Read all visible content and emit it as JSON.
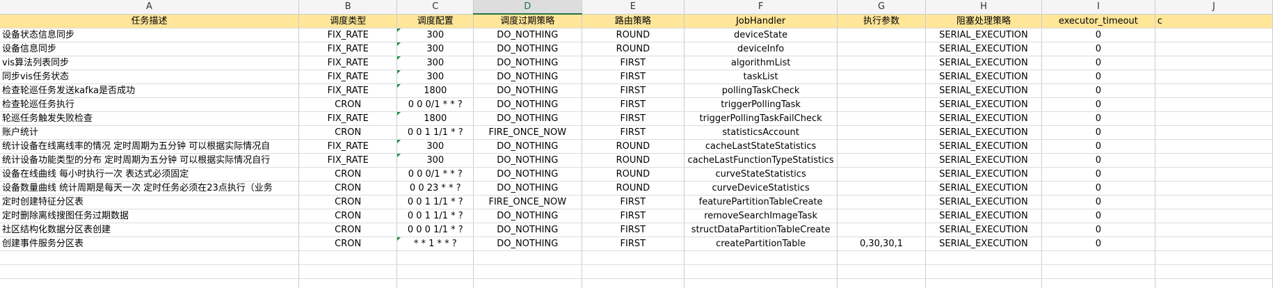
{
  "columns": [
    "A",
    "B",
    "C",
    "D",
    "E",
    "F",
    "G",
    "H",
    "I",
    "J"
  ],
  "active_column_index": 3,
  "colors": {
    "header_fill": "#ffe699",
    "active_column_header": "#217346",
    "comment_flag": "#1e8e3e"
  },
  "header": [
    "任务描述",
    "调度类型",
    "调度配置",
    "调度过期策略",
    "路由策略",
    "JobHandler",
    "执行参数",
    "阻塞处理策略",
    "executor_timeout",
    "c"
  ],
  "rows": [
    {
      "cells": [
        "设备状态信息同步",
        "FIX_RATE",
        "300",
        "DO_NOTHING",
        "ROUND",
        "deviceState",
        "",
        "SERIAL_EXECUTION",
        "0",
        ""
      ],
      "flag": true
    },
    {
      "cells": [
        "设备信息同步",
        "FIX_RATE",
        "300",
        "DO_NOTHING",
        "ROUND",
        "deviceInfo",
        "",
        "SERIAL_EXECUTION",
        "0",
        ""
      ],
      "flag": true
    },
    {
      "cells": [
        "vis算法列表同步",
        "FIX_RATE",
        "300",
        "DO_NOTHING",
        "FIRST",
        "algorithmList",
        "",
        "SERIAL_EXECUTION",
        "0",
        ""
      ],
      "flag": true
    },
    {
      "cells": [
        "同步vis任务状态",
        "FIX_RATE",
        "300",
        "DO_NOTHING",
        "FIRST",
        "taskList",
        "",
        "SERIAL_EXECUTION",
        "0",
        ""
      ],
      "flag": true
    },
    {
      "cells": [
        "检查轮巡任务发送kafka是否成功",
        "FIX_RATE",
        "1800",
        "DO_NOTHING",
        "FIRST",
        "pollingTaskCheck",
        "",
        "SERIAL_EXECUTION",
        "0",
        ""
      ],
      "flag": true
    },
    {
      "cells": [
        "检查轮巡任务执行",
        "CRON",
        "0 0 0/1 * * ?",
        "DO_NOTHING",
        "FIRST",
        "triggerPollingTask",
        "",
        "SERIAL_EXECUTION",
        "0",
        ""
      ],
      "flag": false
    },
    {
      "cells": [
        "轮巡任务触发失败检查",
        "FIX_RATE",
        "1800",
        "DO_NOTHING",
        "FIRST",
        "triggerPollingTaskFailCheck",
        "",
        "SERIAL_EXECUTION",
        "0",
        ""
      ],
      "flag": true
    },
    {
      "cells": [
        "账户统计",
        "CRON",
        "0 0 1 1/1 * ?",
        "FIRE_ONCE_NOW",
        "FIRST",
        "statisticsAccount",
        "",
        "SERIAL_EXECUTION",
        "0",
        ""
      ],
      "flag": false
    },
    {
      "cells": [
        "统计设备在线离线率的情况 定时周期为五分钟 可以根据实际情况自",
        "FIX_RATE",
        "300",
        "DO_NOTHING",
        "ROUND",
        "cacheLastStateStatistics",
        "",
        "SERIAL_EXECUTION",
        "0",
        ""
      ],
      "flag": true
    },
    {
      "cells": [
        "统计设备功能类型的分布 定时周期为五分钟 可以根据实际情况自行",
        "FIX_RATE",
        "300",
        "DO_NOTHING",
        "ROUND",
        "cacheLastFunctionTypeStatistics",
        "",
        "SERIAL_EXECUTION",
        "0",
        ""
      ],
      "flag": true
    },
    {
      "cells": [
        "设备在线曲线 每小时执行一次 表达式必须固定",
        "CRON",
        "0 0 0/1 * * ?",
        "DO_NOTHING",
        "ROUND",
        "curveStateStatistics",
        "",
        "SERIAL_EXECUTION",
        "0",
        ""
      ],
      "flag": false
    },
    {
      "cells": [
        "设备数量曲线 统计周期是每天一次 定时任务必须在23点执行（业务",
        "CRON",
        "0 0 23 * * ?",
        "DO_NOTHING",
        "ROUND",
        "curveDeviceStatistics",
        "",
        "SERIAL_EXECUTION",
        "0",
        ""
      ],
      "flag": false
    },
    {
      "cells": [
        "定时创建特征分区表",
        "CRON",
        "0 0 1 1/1 * ?",
        "FIRE_ONCE_NOW",
        "FIRST",
        "featurePartitionTableCreate",
        "",
        "SERIAL_EXECUTION",
        "0",
        ""
      ],
      "flag": false
    },
    {
      "cells": [
        "定时删除离线搜图任务过期数据",
        "CRON",
        "0 0 1 1/1 * ?",
        "DO_NOTHING",
        "FIRST",
        "removeSearchImageTask",
        "",
        "SERIAL_EXECUTION",
        "0",
        ""
      ],
      "flag": false
    },
    {
      "cells": [
        "社区结构化数据分区表创建",
        "CRON",
        "0 0 0 1/1 * ?",
        "DO_NOTHING",
        "FIRST",
        "structDataPartitionTableCreate",
        "",
        "SERIAL_EXECUTION",
        "0",
        ""
      ],
      "flag": false
    },
    {
      "cells": [
        "创建事件服务分区表",
        "CRON",
        "* * 1 * * ?",
        "DO_NOTHING",
        "FIRST",
        "createPartitionTable",
        "0,30,30,1",
        "SERIAL_EXECUTION",
        "0",
        ""
      ],
      "flag": true
    }
  ],
  "empty_rows": 3
}
